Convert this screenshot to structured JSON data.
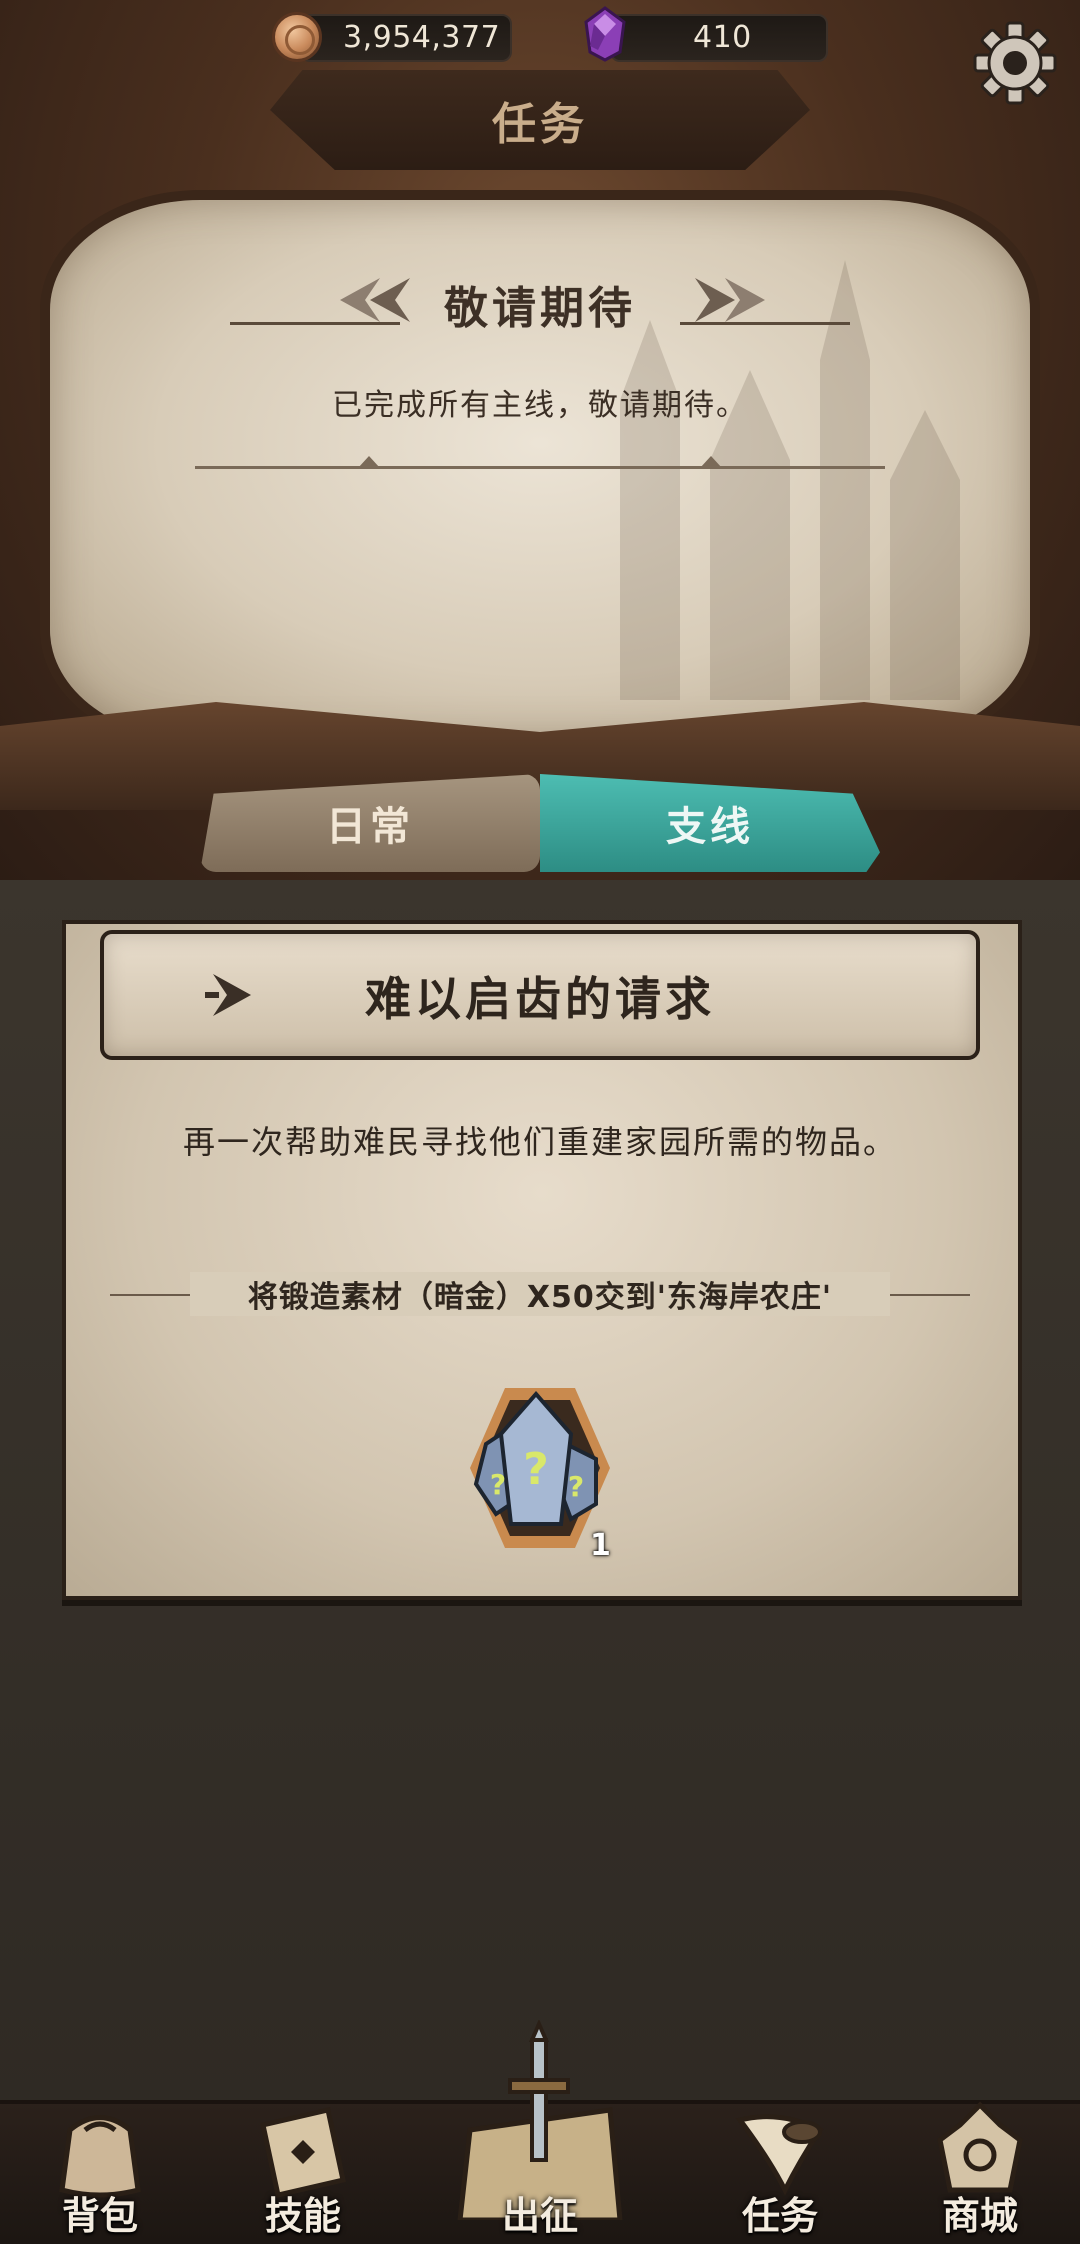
{
  "resources": {
    "coins": "3,954,377",
    "gems": "410"
  },
  "header": {
    "title": "任务"
  },
  "main_banner": {
    "title": "敬请期待",
    "subtitle": "已完成所有主线，敬请期待。"
  },
  "tabs": [
    {
      "label": "日常",
      "selected": false
    },
    {
      "label": "支线",
      "selected": true
    }
  ],
  "quest": {
    "title": "难以启齿的请求",
    "description": "再一次帮助难民寻找他们重建家园所需的物品。",
    "requirement": "将锻造素材（暗金）X50交到'东海岸农庄'",
    "reward": {
      "icon": "mystery-crystal-icon",
      "count": "1"
    }
  },
  "bottom_nav": [
    {
      "label": "背包",
      "icon": "bag-icon"
    },
    {
      "label": "技能",
      "icon": "skill-book-icon"
    },
    {
      "label": "出征",
      "icon": "sword-map-icon"
    },
    {
      "label": "任务",
      "icon": "horn-icon"
    },
    {
      "label": "商城",
      "icon": "shop-crown-icon"
    }
  ],
  "colors": {
    "active_tab": "#3fa9a0",
    "inactive_tab": "#9a8874",
    "parchment": "#e2d7c5",
    "wood": "#4a2f1e"
  }
}
